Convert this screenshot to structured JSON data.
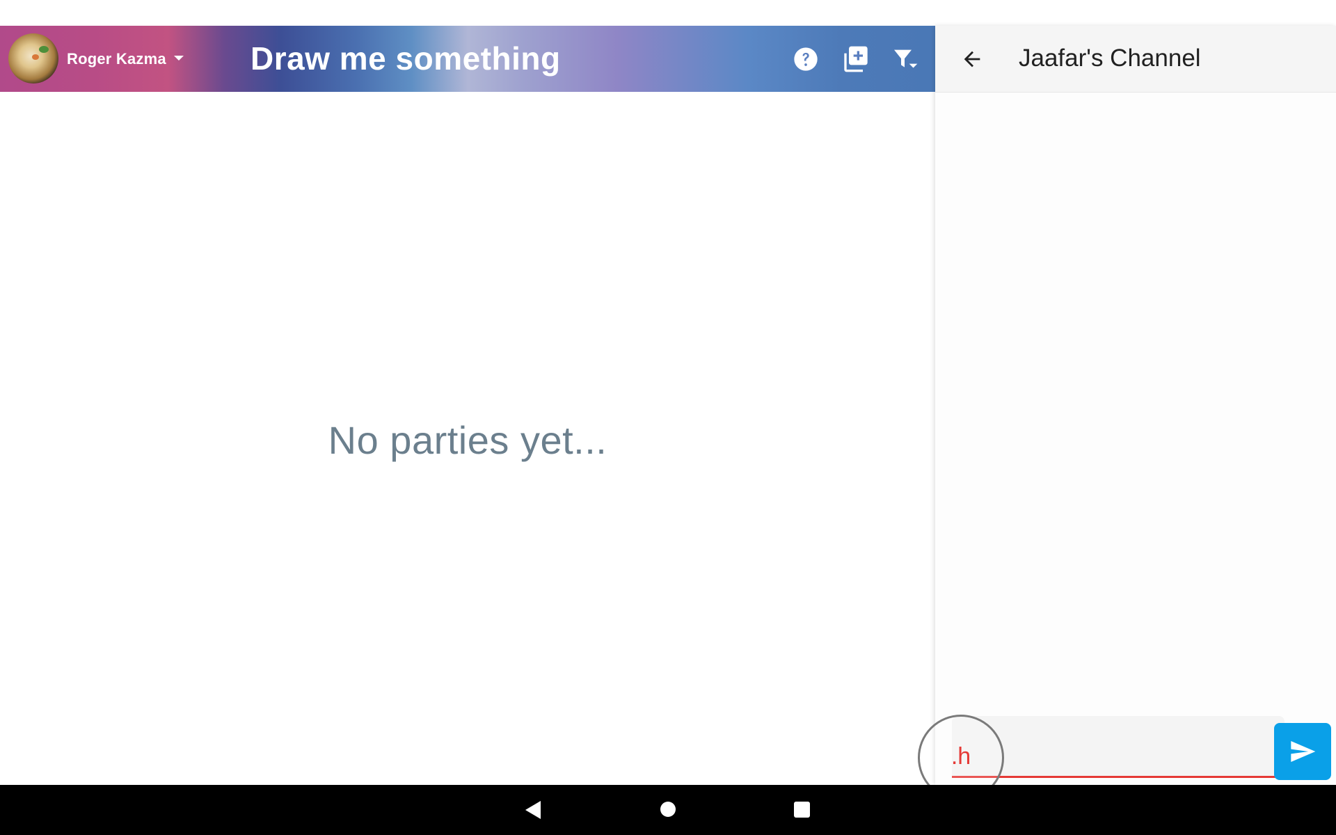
{
  "header": {
    "user_name": "Roger Kazma",
    "app_title": "Draw me something",
    "icons": [
      "help-icon",
      "add-box-icon",
      "filter-icon"
    ]
  },
  "main": {
    "empty_message": "No parties yet..."
  },
  "channel_panel": {
    "title": "Jaafar's Channel",
    "message_input": {
      "value": "",
      "placeholder": ""
    },
    "send_icon": "send-icon",
    "back_icon": "arrow-back-icon"
  },
  "touch_indicator": {
    "text": ".h"
  },
  "colors": {
    "accent_blue": "#0aa0e8",
    "input_error_red": "#e53935",
    "empty_text": "#6b7f8d"
  },
  "system_nav": {
    "buttons": [
      "back",
      "home",
      "recents"
    ]
  }
}
